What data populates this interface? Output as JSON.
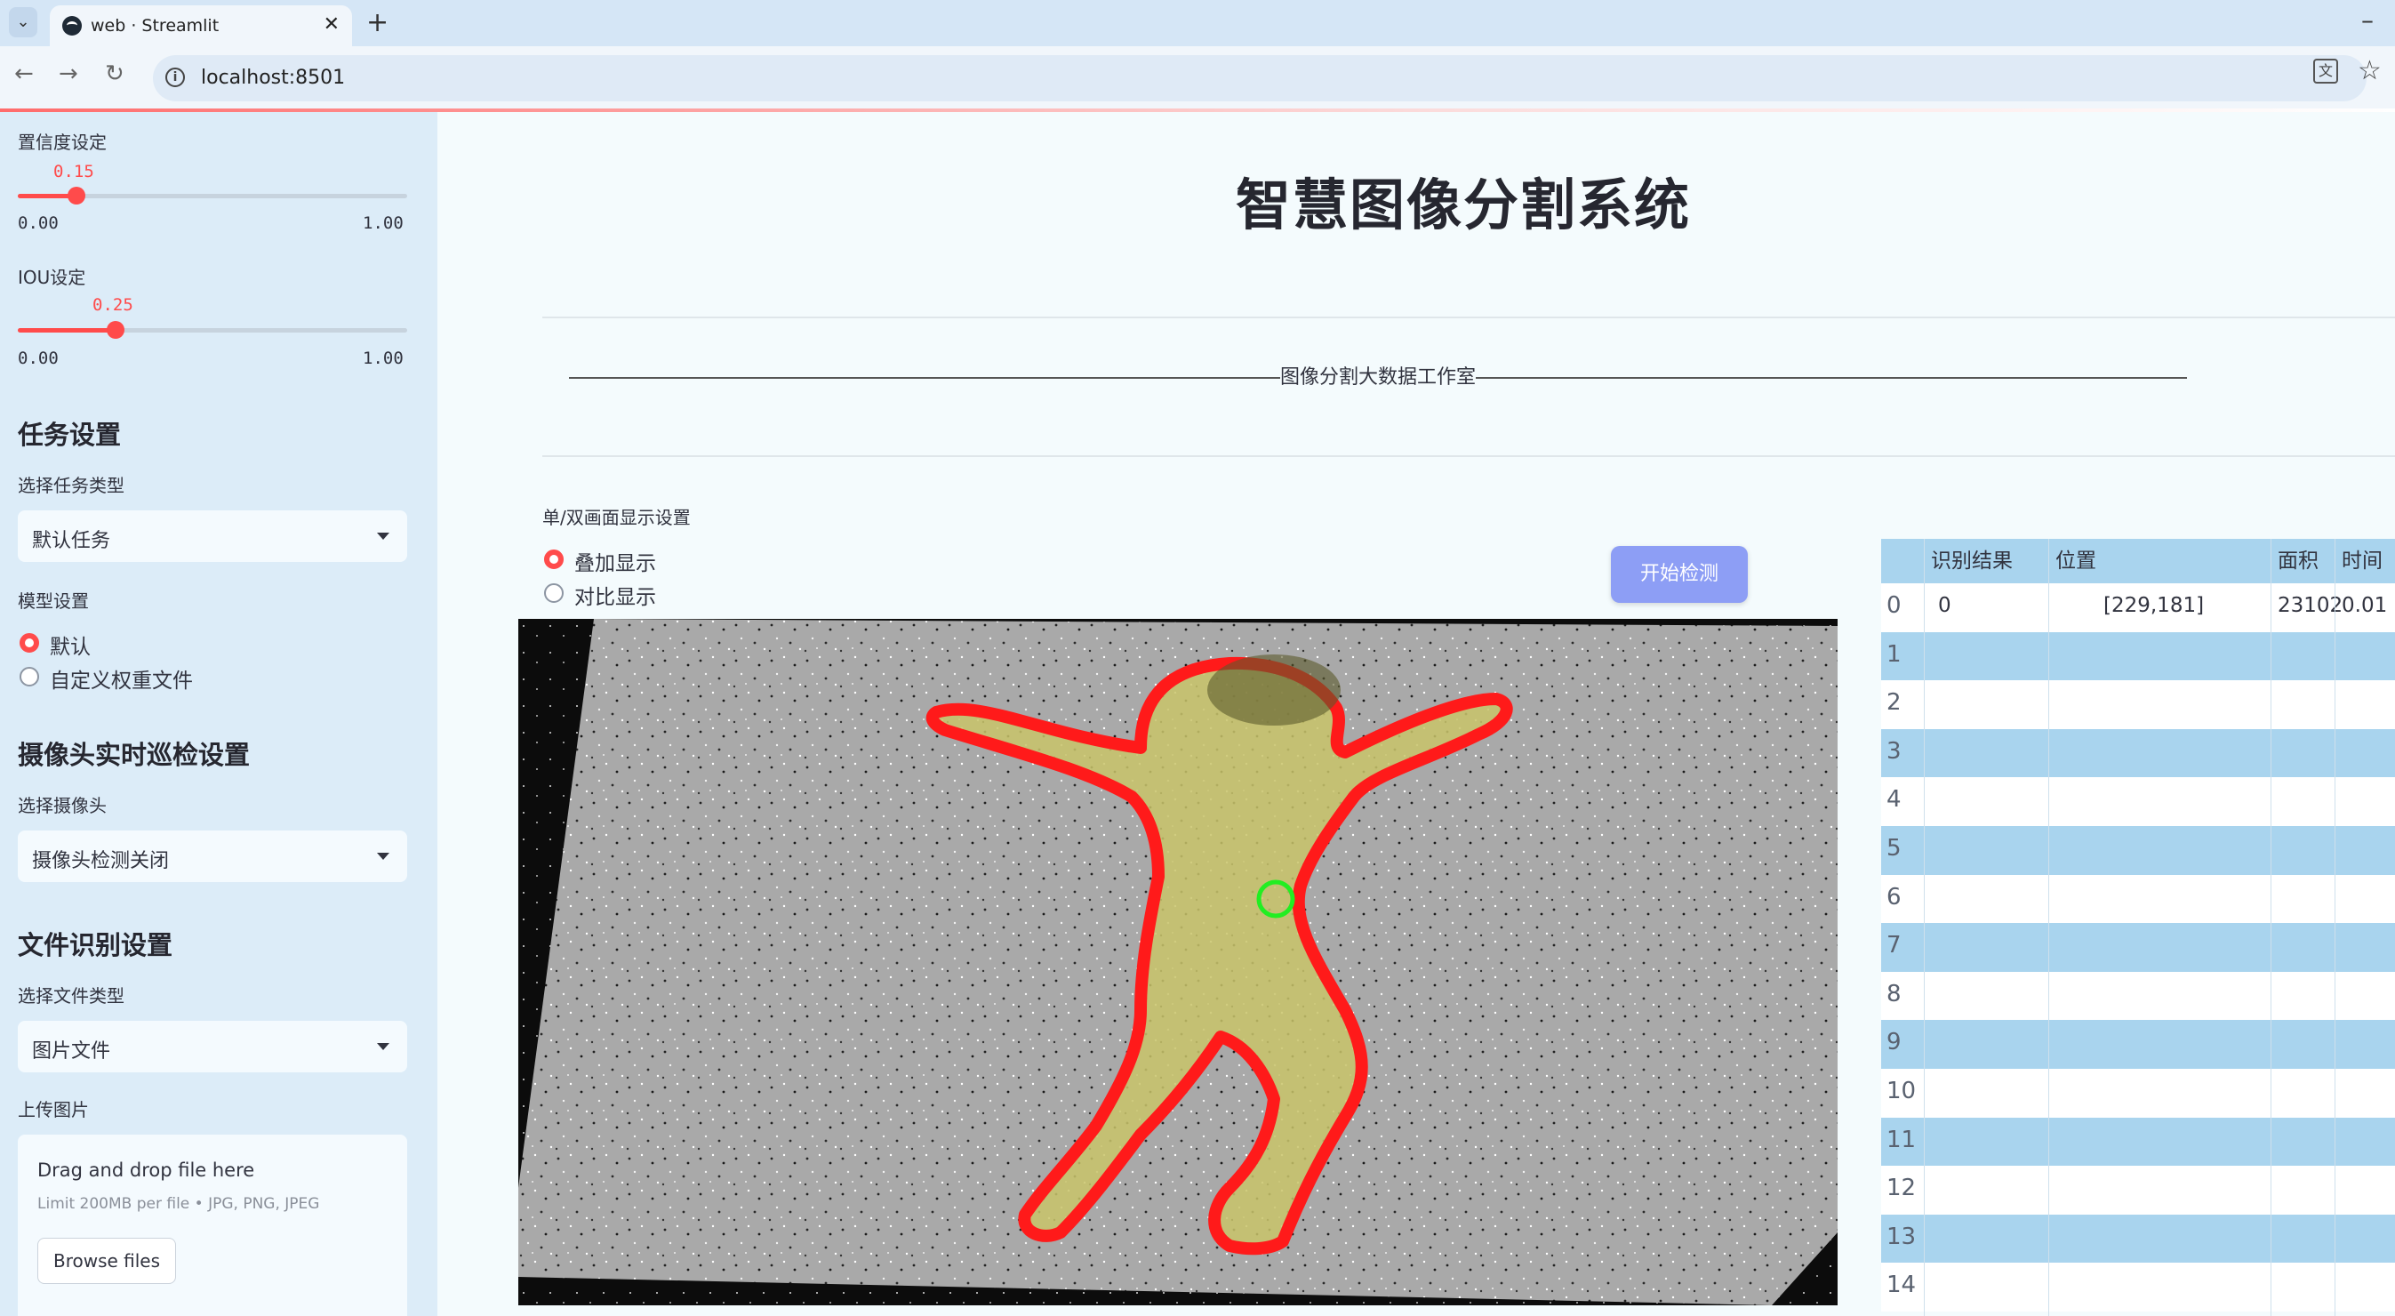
{
  "browser": {
    "tab_title": "web · Streamlit",
    "url": "localhost:8501"
  },
  "sidebar": {
    "confidence": {
      "label": "置信度设定",
      "value": "0.15",
      "fraction": 0.15,
      "min": "0.00",
      "max": "1.00"
    },
    "iou": {
      "label": "IOU设定",
      "value": "0.25",
      "fraction": 0.25,
      "min": "0.00",
      "max": "1.00"
    },
    "task": {
      "heading": "任务设置",
      "label": "选择任务类型",
      "selected": "默认任务"
    },
    "model": {
      "label": "模型设置",
      "options": [
        "默认",
        "自定义权重文件"
      ],
      "selected_index": 0
    },
    "camera": {
      "heading": "摄像头实时巡检设置",
      "label": "选择摄像头",
      "selected": "摄像头检测关闭"
    },
    "file": {
      "heading": "文件识别设置",
      "label": "选择文件类型",
      "selected": "图片文件"
    },
    "upload": {
      "label": "上传图片",
      "title": "Drag and drop file here",
      "hint": "Limit 200MB per file • JPG, PNG, JPEG",
      "button": "Browse files"
    }
  },
  "main": {
    "title": "智慧图像分割系统",
    "subtitle": "图像分割大数据工作室",
    "display_label": "单/双画面显示设置",
    "display_options": [
      "叠加显示",
      "对比显示"
    ],
    "display_selected_index": 0,
    "start_button": "开始检测"
  },
  "results_table": {
    "columns": [
      "识别结果",
      "位置",
      "面积",
      "时间"
    ],
    "rows": [
      {
        "index": "0",
        "result": "0",
        "position": "[229,181]",
        "area": "23102",
        "time": "0.01"
      },
      {
        "index": "1"
      },
      {
        "index": "2"
      },
      {
        "index": "3"
      },
      {
        "index": "4"
      },
      {
        "index": "5"
      },
      {
        "index": "6"
      },
      {
        "index": "7"
      },
      {
        "index": "8"
      },
      {
        "index": "9"
      },
      {
        "index": "10"
      },
      {
        "index": "11"
      },
      {
        "index": "12"
      },
      {
        "index": "13"
      },
      {
        "index": "14"
      }
    ]
  },
  "colors": {
    "accent": "#ff4b4b",
    "button": "#8d9ef5",
    "table_band": "#a9d4ee",
    "mask_outline": "#ff1a1a",
    "mask_fill": "#c9c46a",
    "center_marker": "#22ee22"
  }
}
